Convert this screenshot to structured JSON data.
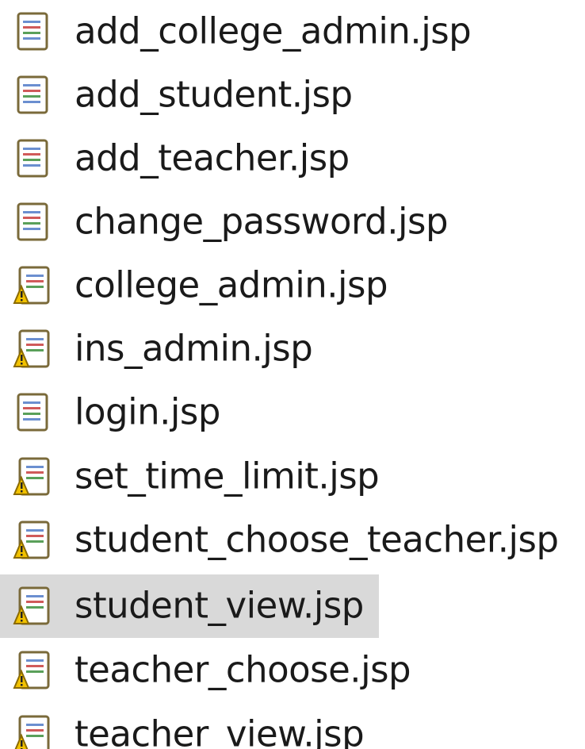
{
  "files": [
    {
      "name": "add_college_admin.jsp",
      "icon": "jsp-file-icon",
      "warning": false,
      "selected": false
    },
    {
      "name": "add_student.jsp",
      "icon": "jsp-file-icon",
      "warning": false,
      "selected": false
    },
    {
      "name": "add_teacher.jsp",
      "icon": "jsp-file-icon",
      "warning": false,
      "selected": false
    },
    {
      "name": "change_password.jsp",
      "icon": "jsp-file-icon",
      "warning": false,
      "selected": false
    },
    {
      "name": "college_admin.jsp",
      "icon": "jsp-file-warning-icon",
      "warning": true,
      "selected": false
    },
    {
      "name": "ins_admin.jsp",
      "icon": "jsp-file-warning-icon",
      "warning": true,
      "selected": false
    },
    {
      "name": "login.jsp",
      "icon": "jsp-file-icon",
      "warning": false,
      "selected": false
    },
    {
      "name": "set_time_limit.jsp",
      "icon": "jsp-file-warning-icon",
      "warning": true,
      "selected": false
    },
    {
      "name": "student_choose_teacher.jsp",
      "icon": "jsp-file-warning-icon",
      "warning": true,
      "selected": false
    },
    {
      "name": "student_view.jsp",
      "icon": "jsp-file-warning-icon",
      "warning": true,
      "selected": true
    },
    {
      "name": "teacher_choose.jsp",
      "icon": "jsp-file-warning-icon",
      "warning": true,
      "selected": false
    },
    {
      "name": "teacher_view.jsp",
      "icon": "jsp-file-warning-icon",
      "warning": true,
      "selected": false
    }
  ],
  "colors": {
    "selection": "#d9d9d9",
    "icon_border": "#7a6a3a",
    "warning": "#f2c200"
  }
}
